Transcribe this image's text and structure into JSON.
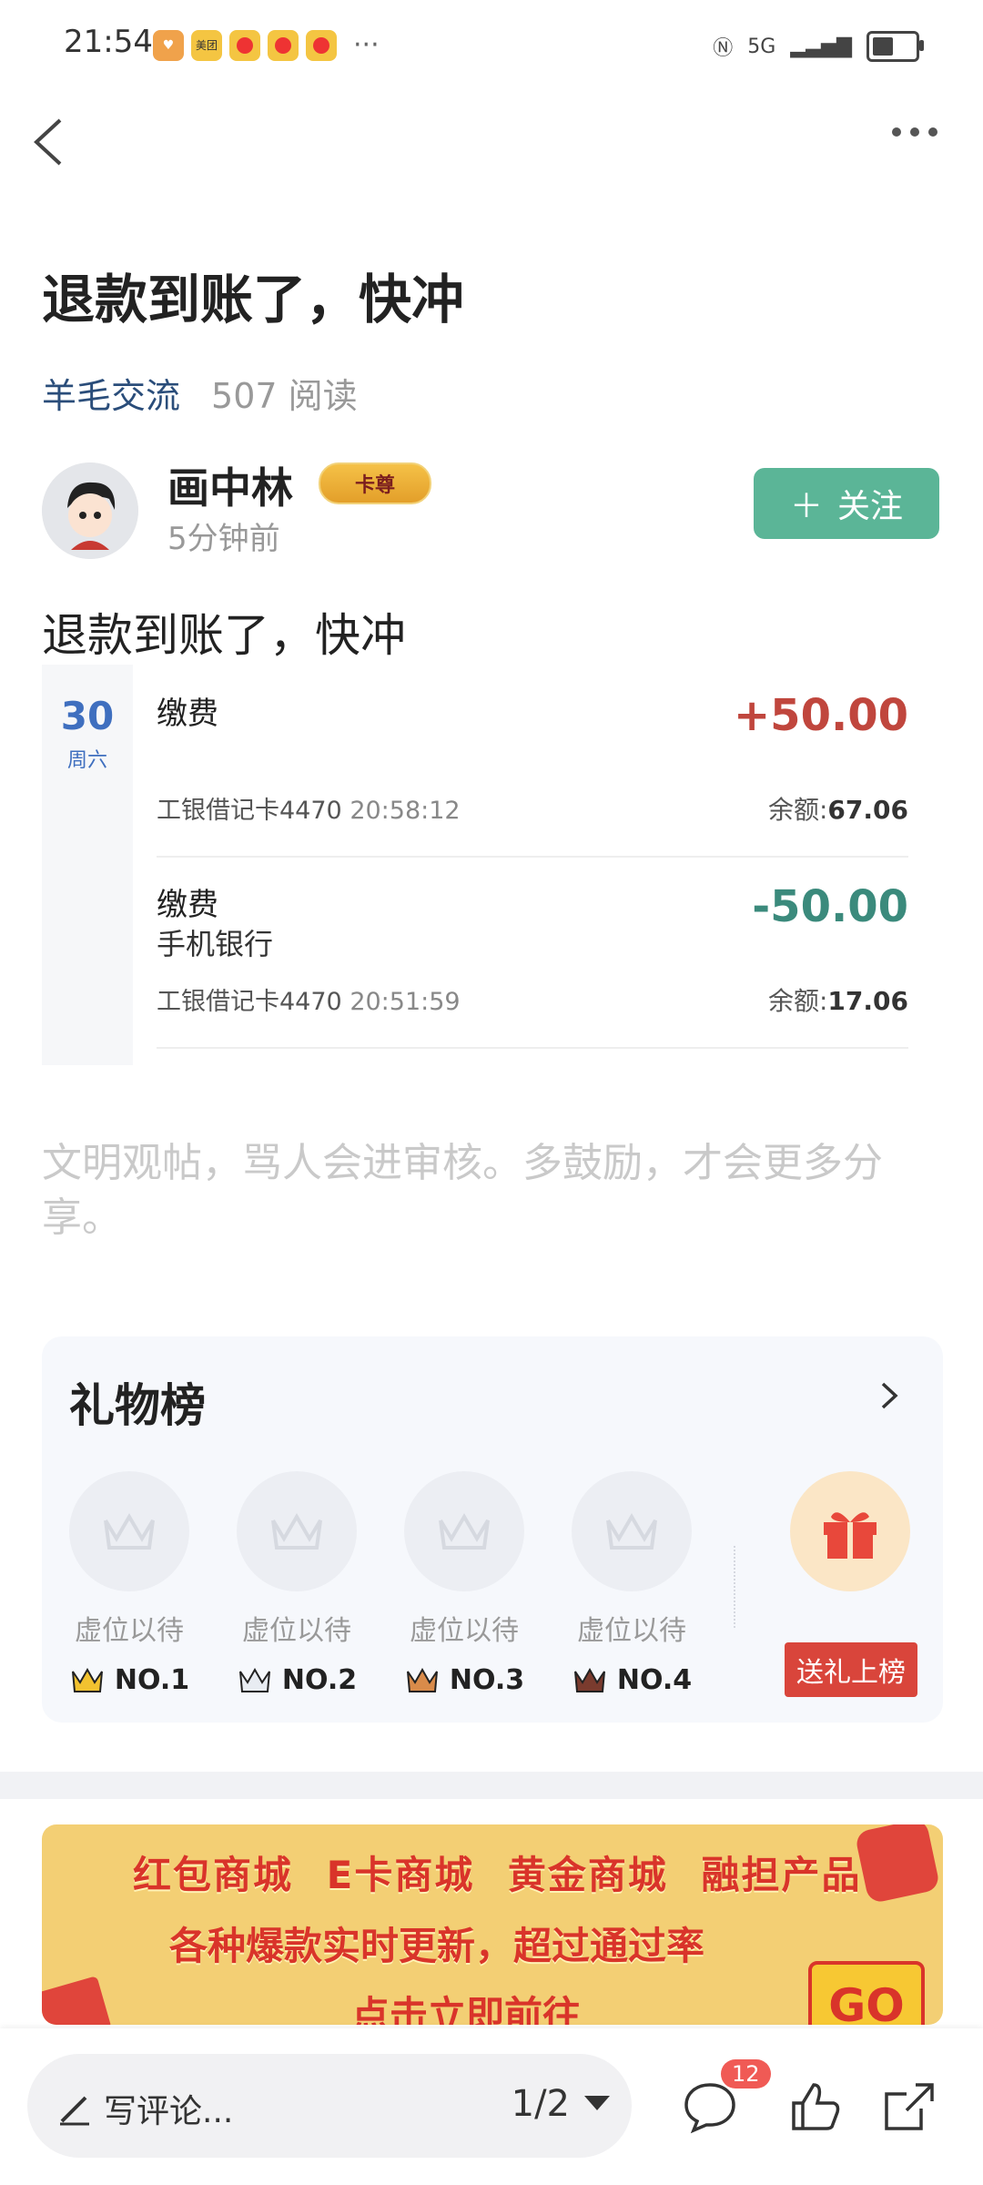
{
  "status": {
    "time": "21:54",
    "app_icons": [
      "shield-app-icon",
      "meituan-icon",
      "weibo-icon",
      "weibo-icon",
      "weibo-icon"
    ],
    "meituan_text": "美团",
    "overflow": "···",
    "network": "5G",
    "colors": {
      "text": "#333333"
    }
  },
  "post": {
    "title": "退款到账了，快冲",
    "group": "羊毛交流",
    "reads": "507 阅读",
    "author": "画中林",
    "badge": "卡尊",
    "time_ago": "5分钟前",
    "follow_label": "关注",
    "body": "退款到账了，快冲"
  },
  "bank": {
    "day": "30",
    "weekday": "周六",
    "transactions": [
      {
        "name": "缴费",
        "sub": "",
        "amount": "+50.00",
        "card": "工银借记卡4470",
        "time": "20:58:12",
        "balance_label": "余额:",
        "balance": "67.06"
      },
      {
        "name": "缴费",
        "sub": "手机银行",
        "amount": "-50.00",
        "card": "工银借记卡4470",
        "time": "20:51:59",
        "balance_label": "余额:",
        "balance": "17.06"
      }
    ]
  },
  "notice": "文明观帖，骂人会进审核。多鼓励，才会更多分享。",
  "gift_board": {
    "title": "礼物榜",
    "slots": [
      {
        "label": "虚位以待",
        "rank": "NO.1"
      },
      {
        "label": "虚位以待",
        "rank": "NO.2"
      },
      {
        "label": "虚位以待",
        "rank": "NO.3"
      },
      {
        "label": "虚位以待",
        "rank": "NO.4"
      }
    ],
    "send_label": "送礼上榜"
  },
  "banner": {
    "row1": "红包商城 E卡商城 黄金商城 融担产品",
    "row2": "各种爆款实时更新，超过通过率",
    "row3": "点击立即前往",
    "go": "GO"
  },
  "bottom": {
    "comment_placeholder": "写评论...",
    "page": "1/2",
    "comment_count": "12"
  },
  "colors": {
    "accent_green": "#5bb597",
    "positive_red": "#c0463d",
    "negative_teal": "#3b8a7c",
    "link_blue": "#2a4d7a",
    "gift_red": "#d9453b"
  }
}
